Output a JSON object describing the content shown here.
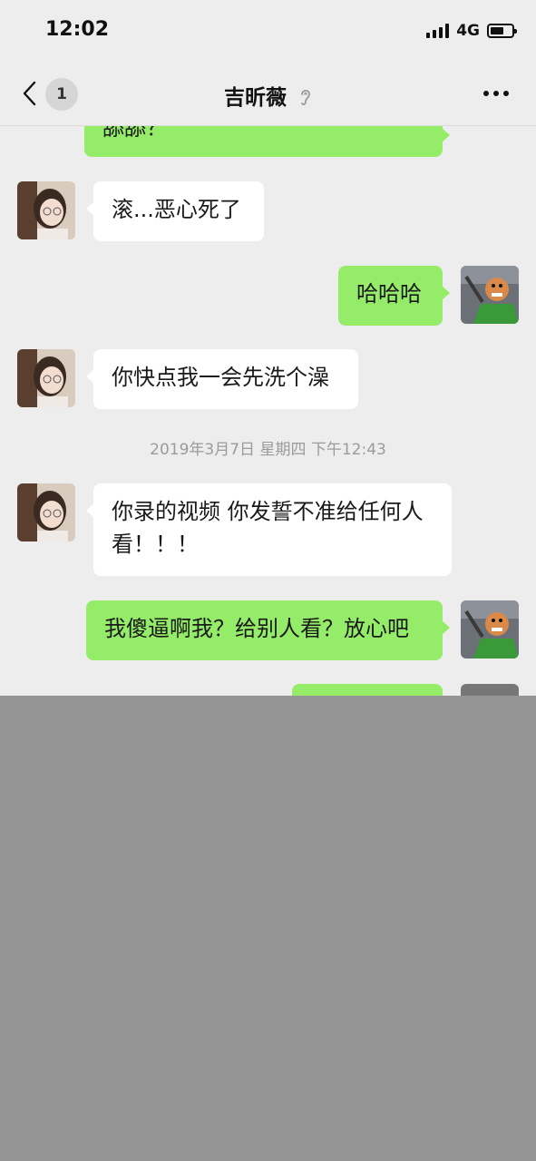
{
  "status_bar": {
    "time": "12:02",
    "network": "4G",
    "battery_level": 0.65
  },
  "nav": {
    "back_icon": "chevron-left-icon",
    "unread_count": "1",
    "title": "吉昕薇",
    "title_icon": "ear-icon",
    "more_icon": "more-dots-icon"
  },
  "chat": {
    "messages": [
      {
        "side": "out",
        "text": "舔舔？"
      },
      {
        "side": "in",
        "text": "滚...恶心死了"
      },
      {
        "side": "out",
        "text": "哈哈哈"
      },
      {
        "side": "in",
        "text": "你快点我一会先洗个澡"
      },
      {
        "side": "in",
        "text": "你录的视频 你发誓不准给任何人看！！！"
      },
      {
        "side": "out",
        "text": "我傻逼啊我？给别人看？放心吧"
      },
      {
        "side": "out",
        "text": ""
      }
    ],
    "timestamp": "2019年3月7日 星期四 下午12:43"
  },
  "colors": {
    "background": "#ededed",
    "outgoing_bubble": "#95ec69",
    "incoming_bubble": "#ffffff",
    "overlay": "#949594"
  }
}
